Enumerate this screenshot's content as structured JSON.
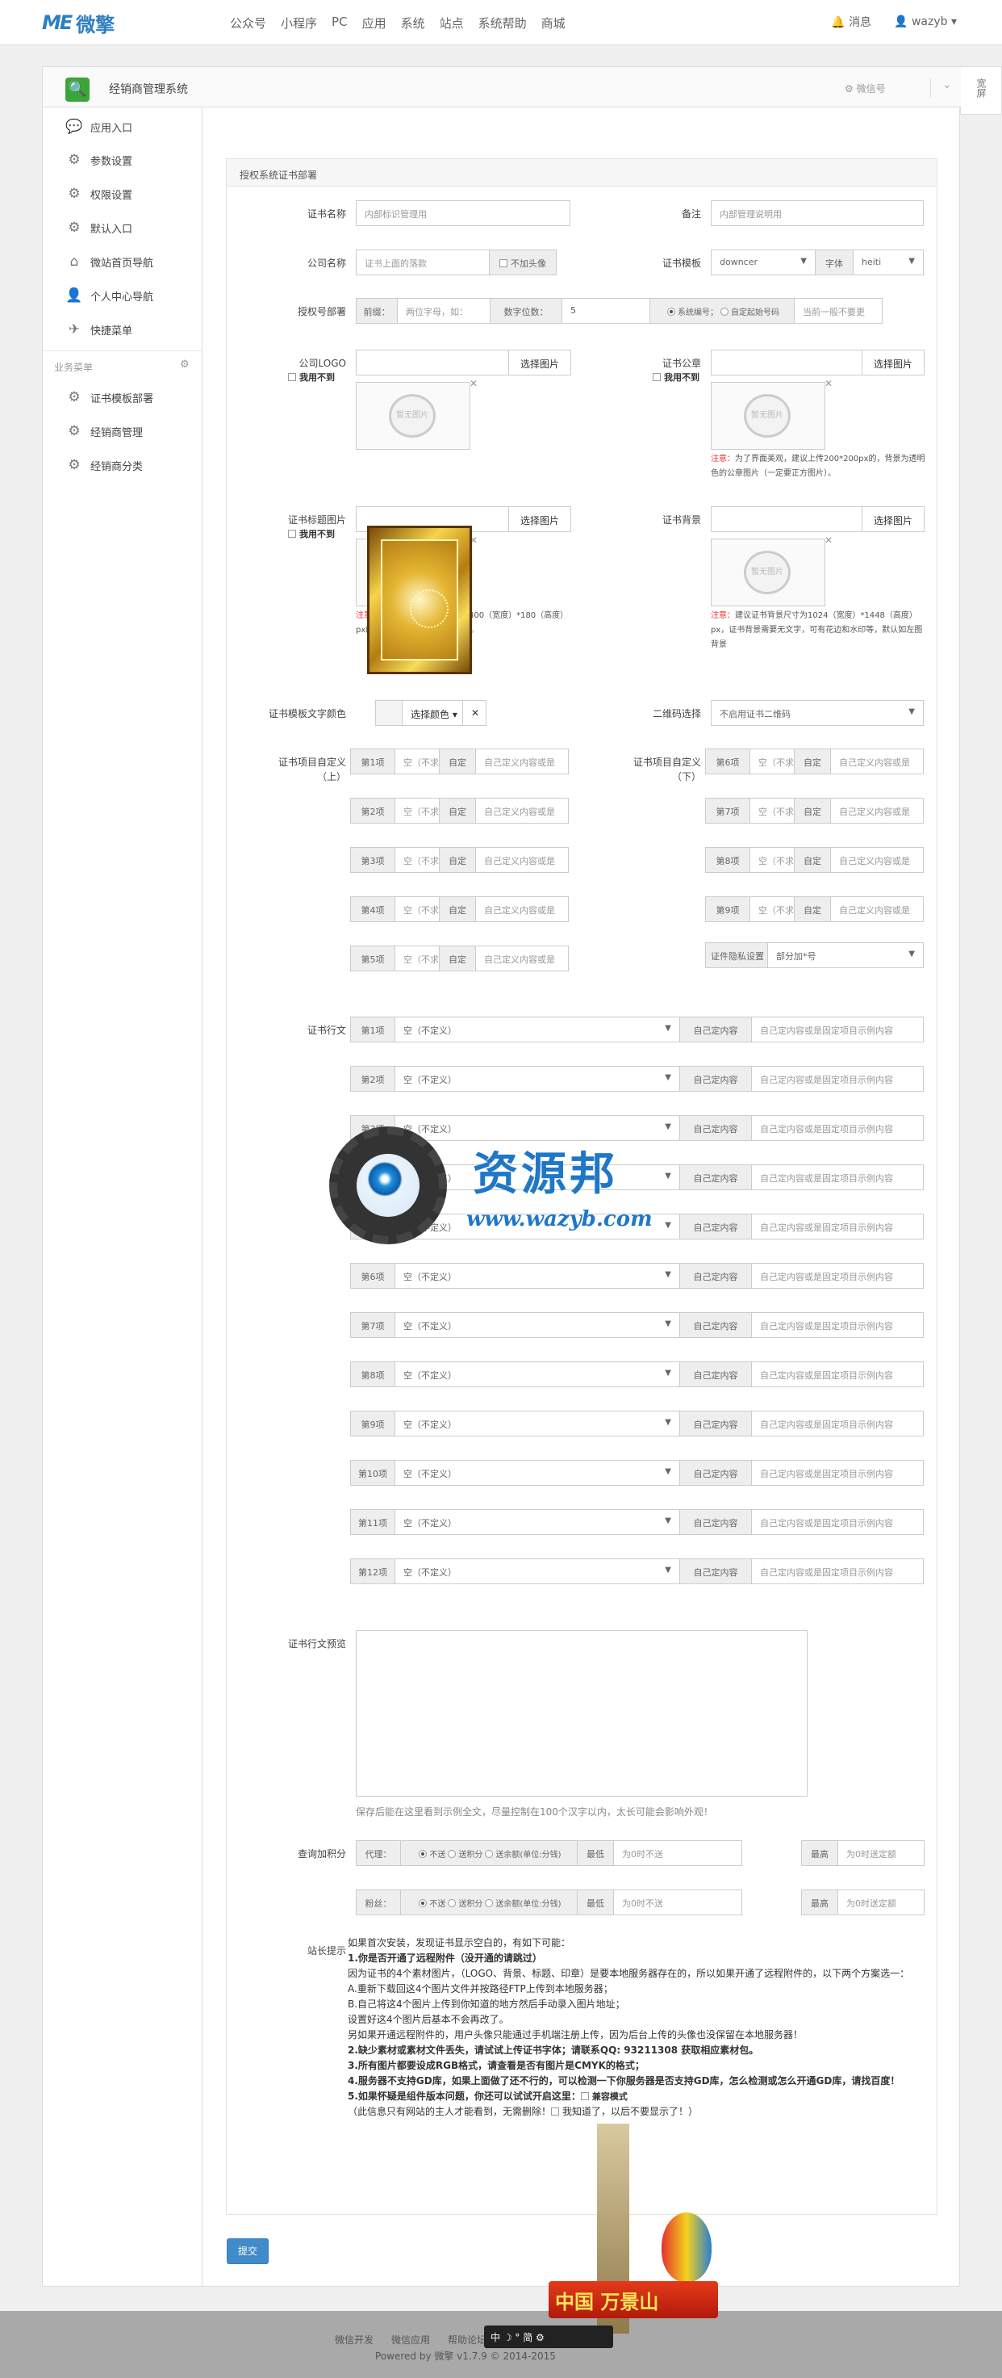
{
  "topbar": {
    "brand_mark": "ME",
    "brand_text": "微擎",
    "nav": [
      "公众号",
      "小程序",
      "PC",
      "应用",
      "系统",
      "站点",
      "系统帮助",
      "商城"
    ],
    "messages": "消息",
    "user": "wazyb"
  },
  "app": {
    "title": "经销商管理系统",
    "switch": "微信号",
    "right_strip": "宽屏"
  },
  "sidebar": {
    "items": [
      "应用入口",
      "参数设置",
      "权限设置",
      "默认入口",
      "微站首页导航",
      "个人中心导航",
      "快捷菜单"
    ],
    "group": "业务菜单",
    "group_items": [
      "证书模板部署",
      "经销商管理",
      "经销商分类"
    ]
  },
  "form": {
    "heading": "授权系统证书部署",
    "cert_name_label": "证书名称",
    "cert_name_ph": "内部标识管理用",
    "remark_label": "备注",
    "remark_ph": "内部管理说明用",
    "company_label": "公司名称",
    "company_ph": "证书上面的落款",
    "no_avatar": "不加头像",
    "template_label": "证书模板",
    "template_val": "downcer",
    "font_label": "字体",
    "font_val": "heiti",
    "no_label": "授权号部署",
    "prefix_label": "前缀：",
    "prefix_ph": "两位字母，如：",
    "digits_label": "数字位数：",
    "digits_val": "5",
    "radio_sys": "系统编号；",
    "radio_custom": "自定起始号码",
    "custom_ph": "当前一般不要更",
    "logo_label": "公司LOGO",
    "logo_unused": "我用不到",
    "choose_img": "选择图片",
    "nopic": "暂无图片",
    "seal_label": "证书公章",
    "seal_unused": "我用不到",
    "seal_note_red": "注意：",
    "seal_note": "为了界面美观，建议上传200*200px的，背景为透明色的公章图片（一定要正方图片）。",
    "title_img_label": "证书标题图片",
    "title_unused": "我用不到",
    "title_note_red": "注意：",
    "title_note": "为了界面美观，建议上传400（宽度）*180（高度）px的，背景为透明色的证书标题。",
    "bg_label": "证书背景",
    "bg_note_red": "注意：",
    "bg_note": "建议证书背景尺寸为1024（宽度）*1448（高度）px，证书背景需要无文字，可有花边和水印等，默认如左图背景",
    "color_label": "证书模板文字颜色",
    "color_btn": "选择颜色",
    "qr_label": "二维码选择",
    "qr_val": "不启用证书二维码",
    "custom_top_label": "证书项目自定义（上）",
    "custom_bottom_label": "证书项目自定义（下）",
    "custom_top_rows": [
      "第1项",
      "第2项",
      "第3项",
      "第4项",
      "第5项"
    ],
    "custom_bottom_rows": [
      "第6项",
      "第7项",
      "第8项",
      "第9项"
    ],
    "custom_empty": "空（不求",
    "custom_define": "自定",
    "custom_content_ph": "自己定义内容或是",
    "privacy_label": "证件隐私设置",
    "privacy_val": "部分加*号",
    "text_label": "证书行文",
    "text_rows": [
      "第1项",
      "第2项",
      "第3项",
      "第4项",
      "第5项",
      "第6项",
      "第7项",
      "第8项",
      "第9项",
      "第10项",
      "第11项",
      "第12项"
    ],
    "text_undefined": "空（不定义）",
    "text_define": "自己定内容",
    "text_content_ph": "自己定内容或是固定项目示例内容",
    "preview_label": "证书行文预览",
    "preview_hint": "保存后能在这里看到示例全文，尽量控制在100个汉字以内，太长可能会影响外观！",
    "query_label": "查询加积分",
    "agent_label": "代理：",
    "fans_label": "粉丝：",
    "opt_none": "不送",
    "opt_points": "送积分",
    "opt_balance": "送余额(单位:分钱)",
    "min_label": "最低",
    "min_ph": "为0时不送",
    "max_label": "最高",
    "max_ph": "为0时送定额"
  },
  "tips": {
    "label": "站长提示",
    "lines": [
      "如果首次安装，发现证书显示空白的，有如下可能：",
      "1.你是否开通了远程附件（没开通的请跳过）",
      "因为证书的4个素材图片，（LOGO、背景、标题、印章）是要本地服务器存在的，所以如果开通了远程附件的，以下两个方案选一：",
      "A.重新下载回这4个图片文件并按路径FTP上传到本地服务器；",
      "B.自己将这4个图片上传到你知道的地方然后手动录入图片地址；",
      "设置好这4个图片后基本不会再改了。",
      "另如果开通远程附件的，用户头像只能通过手机端注册上传，因为后台上传的头像也没保留在本地服务器！",
      "2.缺少素材或素材文件丢失，请试试上传证书字体；请联系QQ: 93211308 获取相应素材包。",
      "3.所有图片都要设成RGB格式，请查看是否有图片是CMYK的格式；",
      "4.服务器不支持GD库，如果上面做了还不行的，可以检测一下你服务器是否支持GD库，怎么检测或怎么开通GD库，请找百度！",
      "5.如果怀疑是组件版本问题，你还可以试试开启这里：",
      "（此信息只有网站的主人才能看到，无需删除！",
      "我知道了，以后不要显示了！）"
    ],
    "compat": "兼容模式"
  },
  "submit": "提交",
  "footer": {
    "links": [
      "微信开发",
      "微信应用",
      "帮助论坛"
    ],
    "copy": "Powered by 微擎 v1.7.9 © 2014-2015"
  },
  "watermark": {
    "cn": "资源邦",
    "url": "www.wazyb.com"
  },
  "badge": {
    "text": "中国  万景山",
    "ime": "中 ☽ ° 简 ⚙"
  }
}
